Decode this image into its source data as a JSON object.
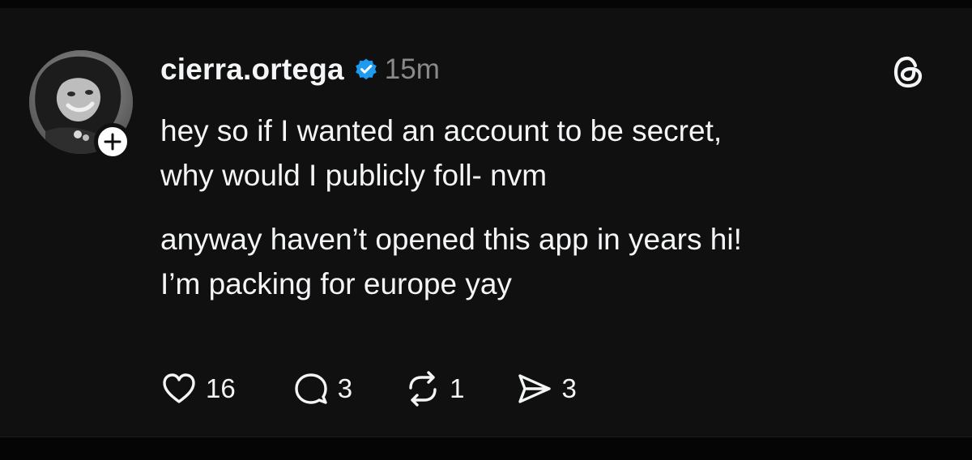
{
  "post": {
    "author": {
      "username": "cierra.ortega",
      "verified": true,
      "verified_icon": "verified-badge-icon",
      "avatar_icon": "avatar-photo",
      "follow_icon": "plus-icon"
    },
    "timestamp": "15m",
    "app_icon": "threads-logo-icon",
    "paragraphs": [
      "hey so if I wanted an account to be secret,\nwhy would I publicly foll- nvm",
      "anyway haven’t opened this app in years hi!\nI’m packing for europe yay"
    ],
    "actions": {
      "like": {
        "icon": "heart-icon",
        "count": "16"
      },
      "reply": {
        "icon": "comment-icon",
        "count": "3"
      },
      "repost": {
        "icon": "repost-icon",
        "count": "1"
      },
      "share": {
        "icon": "send-icon",
        "count": "3"
      }
    }
  },
  "colors": {
    "background": "#101010",
    "text": "#f3f5f7",
    "muted": "#8a8a8a",
    "verified": "#1d9bf0"
  }
}
